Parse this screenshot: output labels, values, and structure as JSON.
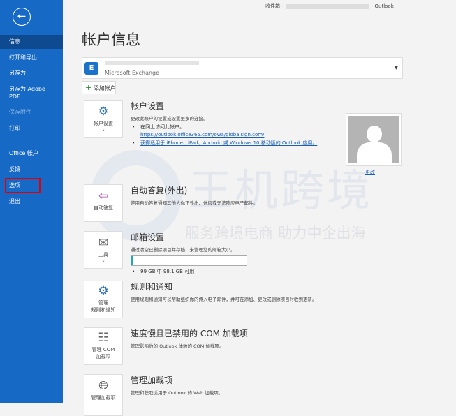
{
  "sidebar": {
    "back": "←",
    "items": [
      {
        "label": "信息"
      },
      {
        "label": "打开和导出"
      },
      {
        "label": "另存为"
      },
      {
        "label": "另存为 Adobe PDF"
      },
      {
        "label": "保存附件"
      },
      {
        "label": "打印"
      },
      {
        "label": "Office 帐户"
      },
      {
        "label": "反馈"
      },
      {
        "label": "选项"
      },
      {
        "label": "退出"
      }
    ]
  },
  "header": {
    "left": "收件箱 -",
    "right": "- Outlook"
  },
  "page_title": "帐户信息",
  "account": {
    "type": "Microsoft Exchange",
    "logo": "E",
    "add_label": "添加帐户"
  },
  "sections": [
    {
      "card": "帐户设置",
      "title": "帐户设置",
      "desc": "更改此帐户的设置或设置更多的连接。",
      "bullet1": "在网上访问此帐户。",
      "link1": "https://outlook.office365.com/owa/globalsign.com/",
      "link2": "获得适用于 iPhone、iPad、Android 或 Windows 10 移动版的 Outlook 应用。"
    },
    {
      "card": "自动答复",
      "title": "自动答复(外出)",
      "desc": "使用自动答复通知其他人你正外出、休假或无法响应电子邮件。"
    },
    {
      "card": "工具",
      "title": "邮箱设置",
      "desc": "通过清空已删除项目并存档，来管理您的邮箱大小。",
      "storage": "99 GB 中 98.1 GB 可用",
      "used_fraction": 0.009
    },
    {
      "card1": "管理",
      "card2": "规则和通知",
      "title": "规则和通知",
      "desc": "使用规则和通知可以帮助组织你的传入电子邮件，并可在添加、更改或删除项目时收到更新。"
    },
    {
      "card1": "管理 COM",
      "card2": "加载项",
      "title": "速度慢且已禁用的 COM 加载项",
      "desc": "管理影响你的 Outlook 体验的 COM 加载项。"
    },
    {
      "card": "管理加载项",
      "title": "管理加载项",
      "desc": "管理和获取适用于 Outlook 的 Web 加载项。"
    }
  ],
  "avatar": {
    "change": "更改"
  },
  "watermark": {
    "big": "王机跨境",
    "tagline": "服务跨境电商 助力中企出海"
  }
}
